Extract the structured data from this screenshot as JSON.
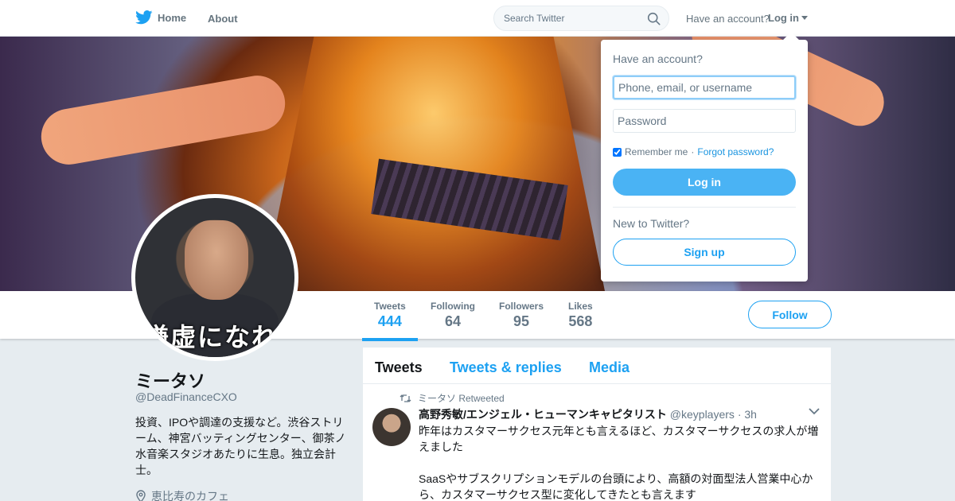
{
  "nav": {
    "home_label": "Home",
    "about_label": "About",
    "search_placeholder": "Search Twitter",
    "have_account_label": "Have an account?",
    "login_label": "Log in",
    "brand_color": "#1da1f2"
  },
  "profile": {
    "name": "ミータソ",
    "handle": "@DeadFinanceCXO",
    "bio": "投資、IPOや調達の支援など。渋谷ストリーム、神宮バッティングセンター、御茶ノ水音楽スタジオあたりに生息。独立会計士。",
    "location": "恵比寿のカフェ",
    "avatar_caption": "謙虚になれ",
    "follow_label": "Follow"
  },
  "stats": [
    {
      "label": "Tweets",
      "value": "444"
    },
    {
      "label": "Following",
      "value": "64"
    },
    {
      "label": "Followers",
      "value": "95"
    },
    {
      "label": "Likes",
      "value": "568"
    }
  ],
  "timeline": {
    "tabs": [
      "Tweets",
      "Tweets & replies",
      "Media"
    ],
    "tweet": {
      "retweet_note": "ミータソ Retweeted",
      "author_name": "高野秀敏/エンジェル・ヒューマンキャピタリスト",
      "author_handle": "@keyplayers",
      "time": "· 3h",
      "text": "昨年はカスタマーサクセス元年とも言えるほど、カスタマーサクセスの求人が増えました\n\nSaaSやサブスクリプションモデルの台頭により、高額の対面型法人営業中心から、カスタマーサクセス型に変化してきたとも言えます"
    }
  },
  "login_dropdown": {
    "title": "Have an account?",
    "username_placeholder": "Phone, email, or username",
    "password_placeholder": "Password",
    "remember_label": "Remember me",
    "separator": "·",
    "forgot_label": "Forgot password?",
    "login_button": "Log in",
    "new_label": "New to Twitter?",
    "signup_button": "Sign up"
  }
}
